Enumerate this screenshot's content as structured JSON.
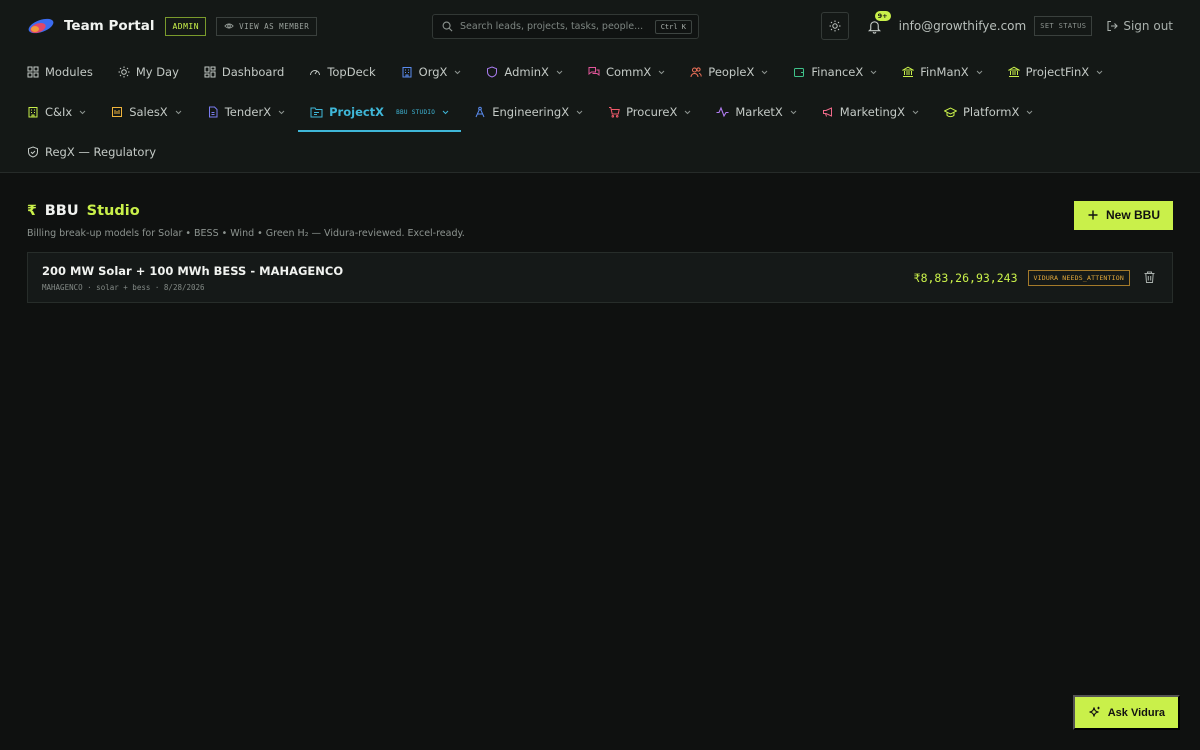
{
  "header": {
    "brand": "Team Portal",
    "admin_badge": "ADMIN",
    "view_as_member": "VIEW AS MEMBER",
    "search": {
      "placeholder": "Search leads, projects, tasks, people...",
      "shortcut": "Ctrl K"
    },
    "notifications_count": "9+",
    "email": "info@growthifye.com",
    "set_status": "SET STATUS",
    "sign_out": "Sign out"
  },
  "nav": {
    "row1": [
      {
        "label": "Modules",
        "icon": "grid-icon"
      },
      {
        "label": "My Day",
        "icon": "sun-icon"
      },
      {
        "label": "Dashboard",
        "icon": "dashboard-icon"
      },
      {
        "label": "TopDeck",
        "icon": "gauge-icon"
      },
      {
        "label": "OrgX",
        "icon": "building-icon"
      },
      {
        "label": "AdminX",
        "icon": "shield-icon"
      },
      {
        "label": "CommX",
        "icon": "chat-icon"
      },
      {
        "label": "PeopleX",
        "icon": "people-icon"
      },
      {
        "label": "FinanceX",
        "icon": "wallet-icon"
      },
      {
        "label": "FinManX",
        "icon": "bank-icon"
      },
      {
        "label": "ProjectFinX",
        "icon": "bank-icon"
      }
    ],
    "row2": [
      {
        "label": "C&Ix",
        "icon": "building-icon"
      },
      {
        "label": "SalesX",
        "icon": "sales-icon"
      },
      {
        "label": "TenderX",
        "icon": "document-icon"
      },
      {
        "label": "ProjectX",
        "icon": "folder-icon",
        "tag": "BBU STUDIO"
      },
      {
        "label": "EngineeringX",
        "icon": "compass-icon"
      },
      {
        "label": "ProcureX",
        "icon": "cart-icon"
      },
      {
        "label": "MarketX",
        "icon": "activity-icon"
      },
      {
        "label": "MarketingX",
        "icon": "megaphone-icon"
      },
      {
        "label": "PlatformX",
        "icon": "graduation-icon"
      }
    ],
    "row3": [
      {
        "label": "RegX — Regulatory",
        "icon": "shield-check-icon"
      }
    ]
  },
  "page": {
    "title_main": "BBU",
    "title_accent": "Studio",
    "subtitle": "Billing break-up models for Solar • BESS • Wind • Green H₂ — Vidura-reviewed. Excel-ready.",
    "new_button": "New BBU"
  },
  "bbu_items": [
    {
      "title": "200 MW Solar + 100 MWh BESS - MAHAGENCO",
      "meta": "MAHAGENCO · solar + bess · 8/28/2026",
      "amount": "₹8,83,26,93,243",
      "status": "VIDURA NEEDS_ATTENTION"
    }
  ],
  "assistant": {
    "label": "Ask Vidura"
  },
  "colors": {
    "accent": "#c9f04a",
    "active_tab": "#3fb7d8",
    "warning": "#e3a93c",
    "background": "#0f1110"
  }
}
